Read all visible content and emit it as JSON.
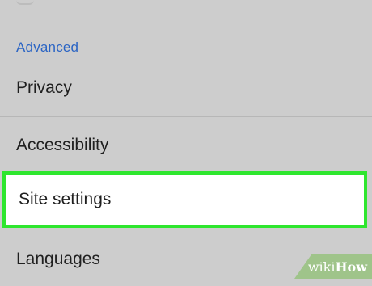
{
  "settings": {
    "section_header": "Advanced",
    "items": [
      {
        "label": "Privacy"
      },
      {
        "label": "Accessibility"
      },
      {
        "label": "Site settings",
        "highlighted": true
      },
      {
        "label": "Languages"
      }
    ]
  },
  "watermark": {
    "prefix": "wiki",
    "suffix": "How"
  },
  "colors": {
    "background": "#cdcdcd",
    "section_header": "#2a64c4",
    "highlight_border": "#2ee62e",
    "highlight_fill": "#ffffff"
  }
}
